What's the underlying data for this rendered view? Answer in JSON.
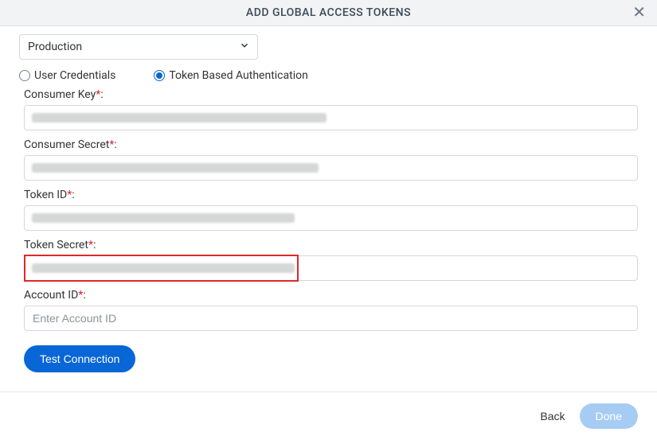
{
  "header": {
    "title": "ADD GLOBAL ACCESS TOKENS"
  },
  "environment": {
    "selected": "Production"
  },
  "auth_method": {
    "options": [
      {
        "label": "User Credentials",
        "selected": false
      },
      {
        "label": "Token Based Authentication",
        "selected": true
      }
    ]
  },
  "fields": {
    "consumer_key": {
      "label": "Consumer Key",
      "value": ""
    },
    "consumer_secret": {
      "label": "Consumer Secret",
      "value": ""
    },
    "token_id": {
      "label": "Token ID",
      "value": ""
    },
    "token_secret": {
      "label": "Token Secret",
      "value": ""
    },
    "account_id": {
      "label": "Account ID",
      "value": "",
      "placeholder": "Enter Account ID"
    }
  },
  "buttons": {
    "test_connection": "Test Connection",
    "back": "Back",
    "done": "Done"
  },
  "required_marker": "*",
  "colon": ":"
}
